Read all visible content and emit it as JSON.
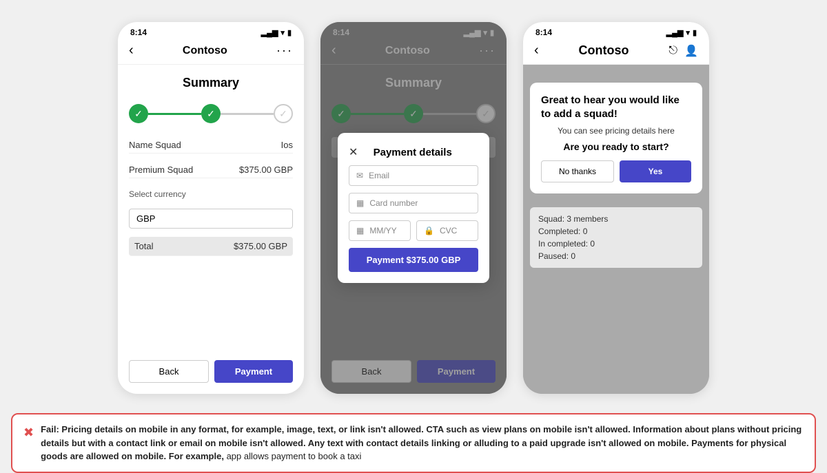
{
  "phones": [
    {
      "id": "phone1",
      "status_time": "8:14",
      "title": "Contoso",
      "summary_title": "Summary",
      "progress_steps": [
        "done",
        "done",
        "pending"
      ],
      "rows": [
        {
          "label": "Name Squad",
          "value": "Ios"
        },
        {
          "label": "Premium Squad",
          "value": "$375.00 GBP"
        }
      ],
      "currency_label": "Select currency",
      "currency_value": "GBP",
      "total_label": "Total",
      "total_value": "$375.00 GBP",
      "btn_back": "Back",
      "btn_payment": "Payment"
    },
    {
      "id": "phone2",
      "status_time": "8:14",
      "title": "Contoso",
      "summary_title": "Summary",
      "progress_steps": [
        "done",
        "done",
        "pending"
      ],
      "modal": {
        "title": "Payment details",
        "email_placeholder": "Email",
        "card_placeholder": "Card number",
        "mm_placeholder": "MM/YY",
        "cvc_placeholder": "CVC",
        "pay_btn": "Payment $375.00 GBP"
      },
      "btn_back": "Back",
      "btn_payment": "Payment"
    },
    {
      "id": "phone3",
      "status_time": "8:14",
      "title": "Contoso",
      "dialog": {
        "title": "Great to hear you would like to add a squad!",
        "subtitle": "You can see pricing details here",
        "question": "Are you ready to start?",
        "btn_no": "No thanks",
        "btn_yes": "Yes"
      },
      "squad_info": {
        "members": "Squad: 3 members",
        "completed": "Completed: 0",
        "in_completed": "In completed: 0",
        "paused": "Paused: 0"
      }
    }
  ],
  "fail": {
    "icon": "✖",
    "text_bold": "Fail: Pricing details on mobile in any format, for example, image, text, or link isn't allowed. CTA such as view plans on mobile isn't allowed. Information about plans without pricing details but with a contact link or email on mobile isn't allowed. Any text with contact details linking or alluding to a paid upgrade isn't allowed on mobile. Payments for physical goods are allowed on mobile. For example,",
    "text_normal": "app allows payment to book a taxi"
  }
}
